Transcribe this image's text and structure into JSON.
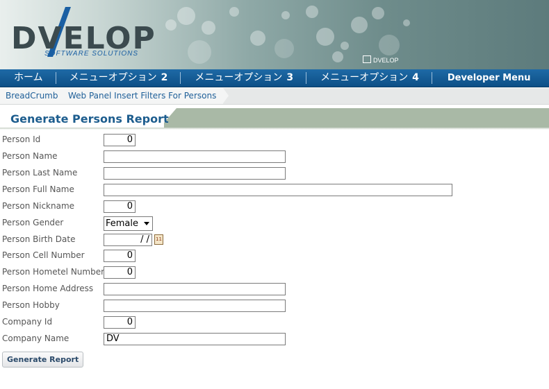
{
  "header": {
    "logo_text": "DVELOP",
    "logo_subtitle": "SOFTWARE SOLUTIONS",
    "small_logo_text": "DVELOP"
  },
  "nav": {
    "items": [
      {
        "label": "ホーム",
        "num": ""
      },
      {
        "label": "メニューオプション",
        "num": "2"
      },
      {
        "label": "メニューオプション",
        "num": "3"
      },
      {
        "label": "メニューオプション",
        "num": "4"
      },
      {
        "label": "Developer Menu",
        "num": ""
      }
    ]
  },
  "breadcrumb": {
    "items": [
      "BreadCrumb",
      "Web Panel Insert Filters For Persons"
    ]
  },
  "page": {
    "title": "Generate Persons Report"
  },
  "form": {
    "person_id": {
      "label": "Person Id",
      "value": "0"
    },
    "person_name": {
      "label": "Person Name",
      "value": ""
    },
    "person_last_name": {
      "label": "Person Last Name",
      "value": ""
    },
    "person_full_name": {
      "label": "Person Full Name",
      "value": ""
    },
    "person_nickname": {
      "label": "Person Nickname",
      "value": "0"
    },
    "person_gender": {
      "label": "Person Gender",
      "value": "Female"
    },
    "person_birth_date": {
      "label": "Person Birth Date",
      "value": "/ /"
    },
    "person_cell_number": {
      "label": "Person Cell Number",
      "value": "0"
    },
    "person_hometel_number": {
      "label": "Person Hometel Number",
      "value": "0"
    },
    "person_home_address": {
      "label": "Person Home Address",
      "value": ""
    },
    "person_hobby": {
      "label": "Person Hobby",
      "value": ""
    },
    "company_id": {
      "label": "Company Id",
      "value": "0"
    },
    "company_name": {
      "label": "Company Name",
      "value": "DV"
    }
  },
  "actions": {
    "generate_label": "Generate Report"
  },
  "colors": {
    "nav": "#135a94",
    "title": "#1d5d8e",
    "strip": "#a9b9a6"
  },
  "icons": {
    "calendar": "calendar-icon",
    "dropdown": "chevron-down-icon"
  }
}
